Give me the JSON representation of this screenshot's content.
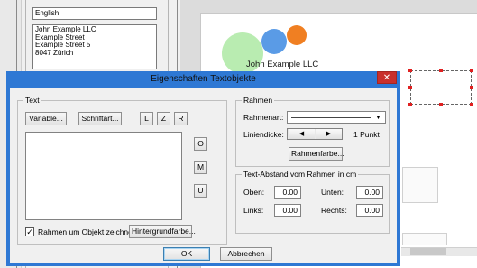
{
  "background": {
    "language_value": "English",
    "address_lines": [
      "John Example LLC",
      "Example Street",
      "Example Street 5",
      "8047 Zürich"
    ],
    "logo_text": "John Example LLC",
    "colors": {
      "circle_green": "#b9ecb1",
      "circle_blue": "#5a9be6",
      "circle_orange": "#f07f22",
      "handle_red": "#e02020"
    }
  },
  "dialog": {
    "title": "Eigenschaften Textobjekte",
    "close_icon": "close-x",
    "text_group": {
      "legend": "Text",
      "variable_button": "Variable...",
      "font_button": "Schriftart...",
      "align_buttons": [
        "L",
        "Z",
        "R"
      ],
      "valign_buttons": [
        "O",
        "M",
        "U"
      ],
      "frame_checkbox_checked": true,
      "frame_checkbox_label": "Rahmen um Objekt zeichnen",
      "background_color_button": "Hintergrundfarbe..."
    },
    "frame_group": {
      "legend": "Rahmen",
      "style_label": "Rahmenart:",
      "width_label": "Liniendicke:",
      "width_value": "1 Punkt",
      "frame_color_button": "Rahmenfarbe..."
    },
    "spacing_group": {
      "legend": "Text-Abstand vom Rahmen in cm",
      "top_label": "Oben:",
      "top_value": "0.00",
      "bottom_label": "Unten:",
      "bottom_value": "0.00",
      "left_label": "Links:",
      "left_value": "0.00",
      "right_label": "Rechts:",
      "right_value": "0.00"
    },
    "ok_button": "OK",
    "cancel_button": "Abbrechen"
  }
}
